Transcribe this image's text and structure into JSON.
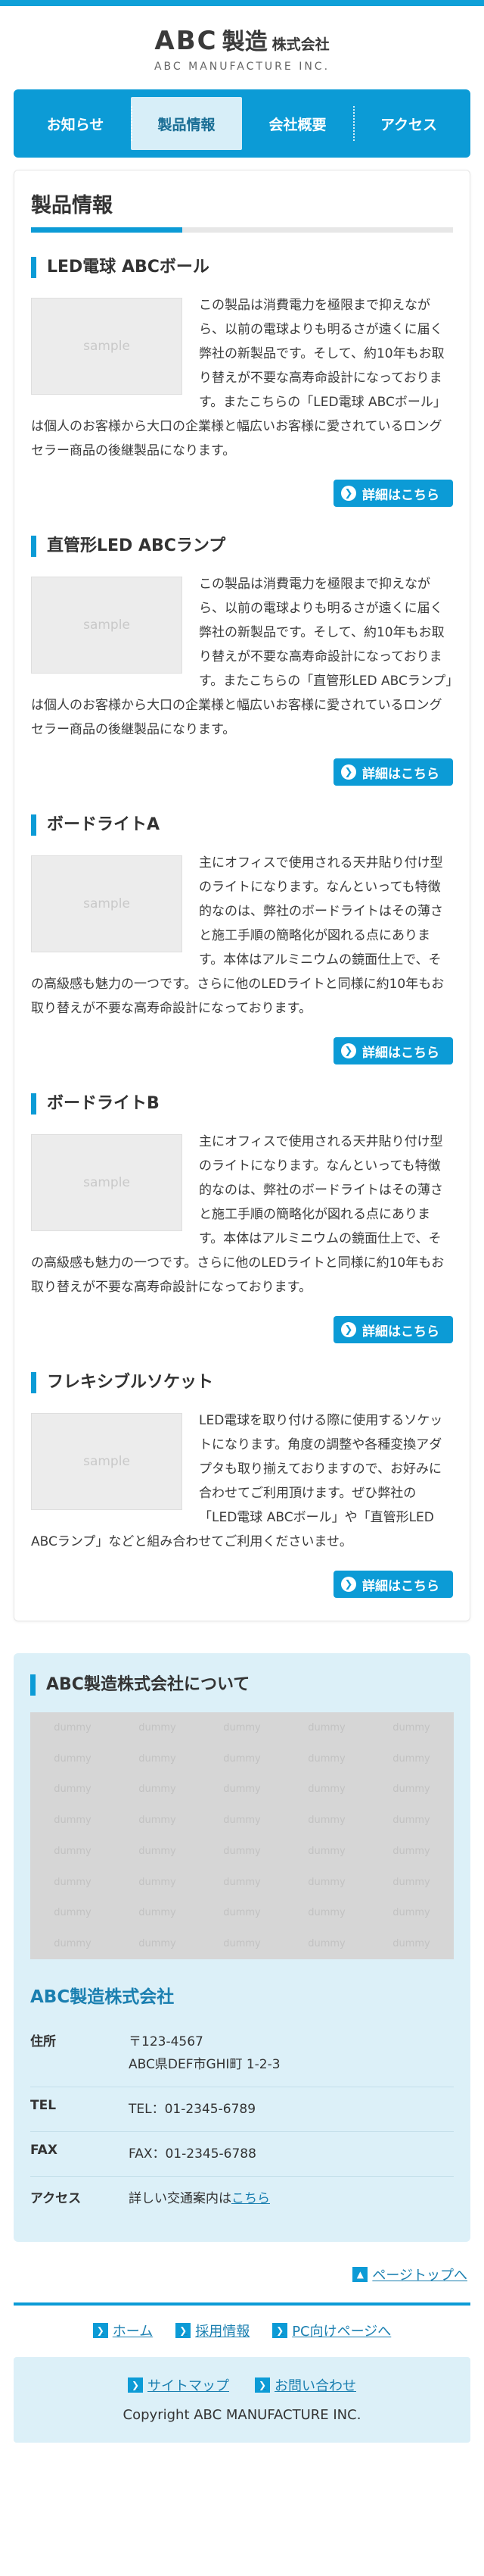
{
  "header": {
    "logo_abc": "ABC",
    "logo_seizo": "製造",
    "logo_kk": "株式会社",
    "logo_sub": "ABC MANUFACTURE INC."
  },
  "nav": {
    "items": [
      {
        "label": "お知らせ",
        "active": false
      },
      {
        "label": "製品情報",
        "active": true
      },
      {
        "label": "会社概要",
        "active": false
      },
      {
        "label": "アクセス",
        "active": false
      }
    ]
  },
  "products": {
    "title": "製品情報",
    "image_label": "sample",
    "detail_label": "詳細はこちら",
    "items": [
      {
        "name": "LED電球 ABCボール",
        "desc": "この製品は消費電力を極限まで抑えながら、以前の電球よりも明るさが遠くに届く弊社の新製品です。そして、約10年もお取り替えが不要な高寿命設計になっております。またこちらの「LED電球 ABCボール」は個人のお客様から大口の企業様と幅広いお客様に愛されているロングセラー商品の後継製品になります。"
      },
      {
        "name": "直管形LED ABCランプ",
        "desc": "この製品は消費電力を極限まで抑えながら、以前の電球よりも明るさが遠くに届く弊社の新製品です。そして、約10年もお取り替えが不要な高寿命設計になっております。またこちらの「直管形LED ABCランプ」は個人のお客様から大口の企業様と幅広いお客様に愛されているロングセラー商品の後継製品になります。"
      },
      {
        "name": "ボードライトA",
        "desc": "主にオフィスで使用される天井貼り付け型のライトになります。なんといっても特徴的なのは、弊社のボードライトはその薄さと施工手順の簡略化が図れる点にあります。本体はアルミニウムの鏡面仕上で、その高級感も魅力の一つです。さらに他のLEDライトと同様に約10年もお取り替えが不要な高寿命設計になっております。"
      },
      {
        "name": "ボードライトB",
        "desc": "主にオフィスで使用される天井貼り付け型のライトになります。なんといっても特徴的なのは、弊社のボードライトはその薄さと施工手順の簡略化が図れる点にあります。本体はアルミニウムの鏡面仕上で、その高級感も魅力の一つです。さらに他のLEDライトと同様に約10年もお取り替えが不要な高寿命設計になっております。"
      },
      {
        "name": "フレキシブルソケット",
        "desc": "LED電球を取り付ける際に使用するソケットになります。角度の調整や各種変換アダプタも取り揃えておりますので、お好みに合わせてご利用頂けます。ぜひ弊社の「LED電球 ABCボール」や「直管形LED ABCランプ」などと組み合わせてご利用くださいませ。"
      }
    ]
  },
  "about": {
    "title": "ABC製造株式会社について",
    "map_label": "dummy",
    "company_name": "ABC製造株式会社",
    "address_label": "住所",
    "postal": "〒123-4567",
    "address": "ABC県DEF市GHI町 1-2-3",
    "tel_label": "TEL",
    "tel": "TEL：01-2345-6789",
    "fax_label": "FAX",
    "fax": "FAX：01-2345-6788",
    "access_label": "アクセス",
    "access_text": "詳しい交通案内は",
    "access_link": "こちら"
  },
  "pagetop": {
    "label": "ページトップへ"
  },
  "footer": {
    "links1": [
      "ホーム",
      "採用情報",
      "PC向けページへ"
    ],
    "links2": [
      "サイトマップ",
      "お問い合わせ"
    ],
    "copyright": "Copyright ABC MANUFACTURE INC."
  },
  "colors": {
    "accent": "#0c9bd6",
    "light_bg": "#dcf0f8",
    "link": "#1a7fb0"
  }
}
